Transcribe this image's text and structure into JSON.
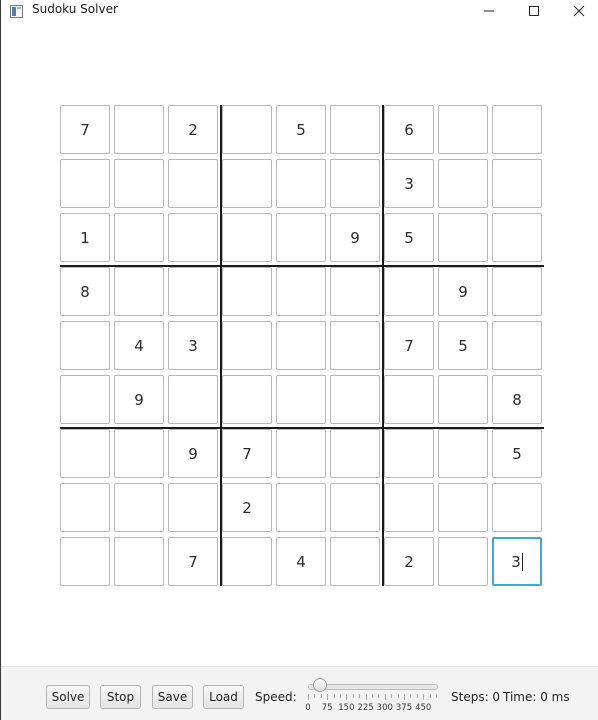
{
  "window": {
    "title": "Sudoku Solver",
    "controls": {
      "minimize": "minimize-icon",
      "maximize": "maximize-icon",
      "close": "close-icon"
    }
  },
  "board": {
    "rows": [
      [
        "7",
        "",
        "2",
        "",
        "5",
        "",
        "6",
        "",
        ""
      ],
      [
        "",
        "",
        "",
        "",
        "",
        "",
        "3",
        "",
        ""
      ],
      [
        "1",
        "",
        "",
        "",
        "",
        "9",
        "5",
        "",
        ""
      ],
      [
        "8",
        "",
        "",
        "",
        "",
        "",
        "",
        "9",
        ""
      ],
      [
        "",
        "4",
        "3",
        "",
        "",
        "",
        "7",
        "5",
        ""
      ],
      [
        "",
        "9",
        "",
        "",
        "",
        "",
        "",
        "",
        "8"
      ],
      [
        "",
        "",
        "9",
        "7",
        "",
        "",
        "",
        "",
        "5"
      ],
      [
        "",
        "",
        "",
        "2",
        "",
        "",
        "",
        "",
        ""
      ],
      [
        "",
        "",
        "7",
        "",
        "4",
        "",
        "2",
        "",
        "3"
      ]
    ],
    "focused_cell": {
      "row": 8,
      "col": 8
    }
  },
  "controls": {
    "solve_label": "Solve",
    "stop_label": "Stop",
    "save_label": "Save",
    "load_label": "Load",
    "speed_label": "Speed:",
    "speed_value": 0,
    "speed_min": 0,
    "speed_max": 500,
    "speed_ticks": [
      "0",
      "75",
      "150",
      "225",
      "300",
      "375",
      "450"
    ],
    "steps_text": "Steps: 0",
    "time_text": "Time: 0 ms"
  },
  "colors": {
    "focus_border": "#3fa9d6",
    "block_divider": "#1a1a1a",
    "cell_border": "#b8b8b8"
  }
}
